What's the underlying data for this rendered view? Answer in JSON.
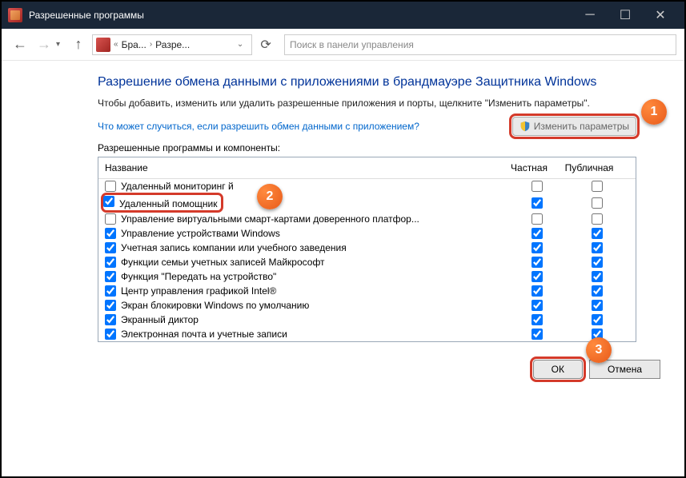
{
  "titlebar": {
    "title": "Разрешенные программы"
  },
  "toolbar": {
    "breadcrumb": {
      "item1": "Бра...",
      "item2": "Разре..."
    },
    "search_placeholder": "Поиск в панели управления"
  },
  "heading": "Разрешение обмена данными с приложениями в брандмауэре Защитника Windows",
  "description": "Чтобы добавить, изменить или удалить разрешенные приложения и порты, щелкните \"Изменить параметры\".",
  "link": "Что может случиться, если разрешить обмен данными с приложением?",
  "change_btn": "Изменить параметры",
  "list": {
    "group_label": "Разрешенные программы и компоненты:",
    "headers": {
      "name": "Название",
      "private": "Частная",
      "public": "Публичная"
    },
    "rows": [
      {
        "name": "Удаленный мониторинг       й",
        "checked": false,
        "private": false,
        "public": false
      },
      {
        "name": "Удаленный помощник",
        "checked": true,
        "private": true,
        "public": false,
        "highlight": true
      },
      {
        "name": "Управление виртуальными смарт-картами доверенного платфор...",
        "checked": false,
        "private": false,
        "public": false
      },
      {
        "name": "Управление устройствами Windows",
        "checked": true,
        "private": true,
        "public": true
      },
      {
        "name": "Учетная запись компании или учебного заведения",
        "checked": true,
        "private": true,
        "public": true
      },
      {
        "name": "Функции семьи учетных записей Майкрософт",
        "checked": true,
        "private": true,
        "public": true
      },
      {
        "name": "Функция \"Передать на устройство\"",
        "checked": true,
        "private": true,
        "public": true
      },
      {
        "name": "Центр управления графикой Intel®",
        "checked": true,
        "private": true,
        "public": true
      },
      {
        "name": "Экран блокировки Windows по умолчанию",
        "checked": true,
        "private": true,
        "public": true
      },
      {
        "name": "Экранный диктор",
        "checked": true,
        "private": true,
        "public": true
      },
      {
        "name": "Электронная почта и учетные записи",
        "checked": true,
        "private": true,
        "public": true
      }
    ]
  },
  "footer": {
    "ok": "ОК",
    "cancel": "Отмена"
  },
  "callouts": {
    "c1": "1",
    "c2": "2",
    "c3": "3"
  }
}
